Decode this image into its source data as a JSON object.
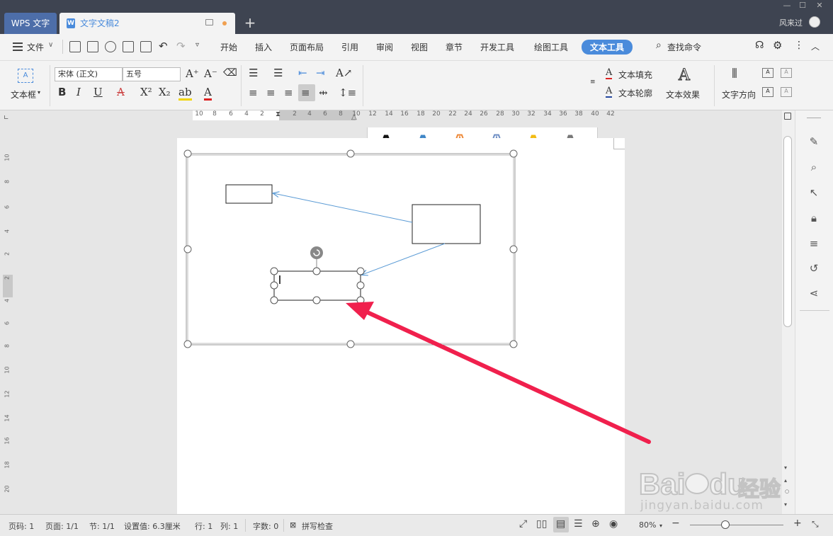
{
  "titlebar": {
    "app_tab": "WPS 文字",
    "doc_tab": "文字文稿2",
    "user": "风来过",
    "new_tab": "+"
  },
  "menu": {
    "file": "文件",
    "items": [
      "开始",
      "插入",
      "页面布局",
      "引用",
      "审阅",
      "视图",
      "章节",
      "开发工具",
      "绘图工具"
    ],
    "active": "文本工具",
    "search": "查找命令"
  },
  "ribbon": {
    "textbox": "文本框",
    "font_name": "宋体 (正文)",
    "font_size": "五号",
    "text_fill": "文本填充",
    "text_outline": "文本轮廓",
    "text_effect": "文本效果",
    "text_direction": "文字方向",
    "style_letter": "A"
  },
  "styles": [
    {
      "color": "#111111",
      "outline": false
    },
    {
      "color": "#3f86c7",
      "outline": false
    },
    {
      "color": "#ee8a3a",
      "outline": true
    },
    {
      "color": "#6f8fc4",
      "outline": true
    },
    {
      "color": "#f2bb12",
      "outline": false
    },
    {
      "color": "#777777",
      "outline": false
    }
  ],
  "ruler": {
    "numbers": [
      "10",
      "8",
      "6",
      "4",
      "2",
      "2",
      "4",
      "6",
      "8",
      "10",
      "12",
      "14",
      "16",
      "18",
      "20",
      "22",
      "24",
      "26",
      "28",
      "30",
      "32",
      "34",
      "36",
      "38",
      "40",
      "42"
    ]
  },
  "vruler": {
    "numbers": [
      "10",
      "8",
      "6",
      "4",
      "2",
      "2",
      "4",
      "6",
      "8",
      "10",
      "12",
      "14",
      "16",
      "18",
      "20"
    ]
  },
  "status": {
    "page_num": "页码: 1",
    "pages": "页面: 1/1",
    "section": "节: 1/1",
    "setting": "设置值: 6.3厘米",
    "row": "行: 1",
    "col": "列: 1",
    "words": "字数: 0",
    "spell": "拼写检查",
    "zoom": "80%"
  },
  "colors": {
    "accent": "#4a8bdb",
    "arrow": "#f0204d",
    "connector": "#5b9bd5"
  },
  "watermark": {
    "brand": "Bai",
    "brand_suffix": "du",
    "site_name": "经验",
    "url": "jingyan.baidu.com"
  }
}
